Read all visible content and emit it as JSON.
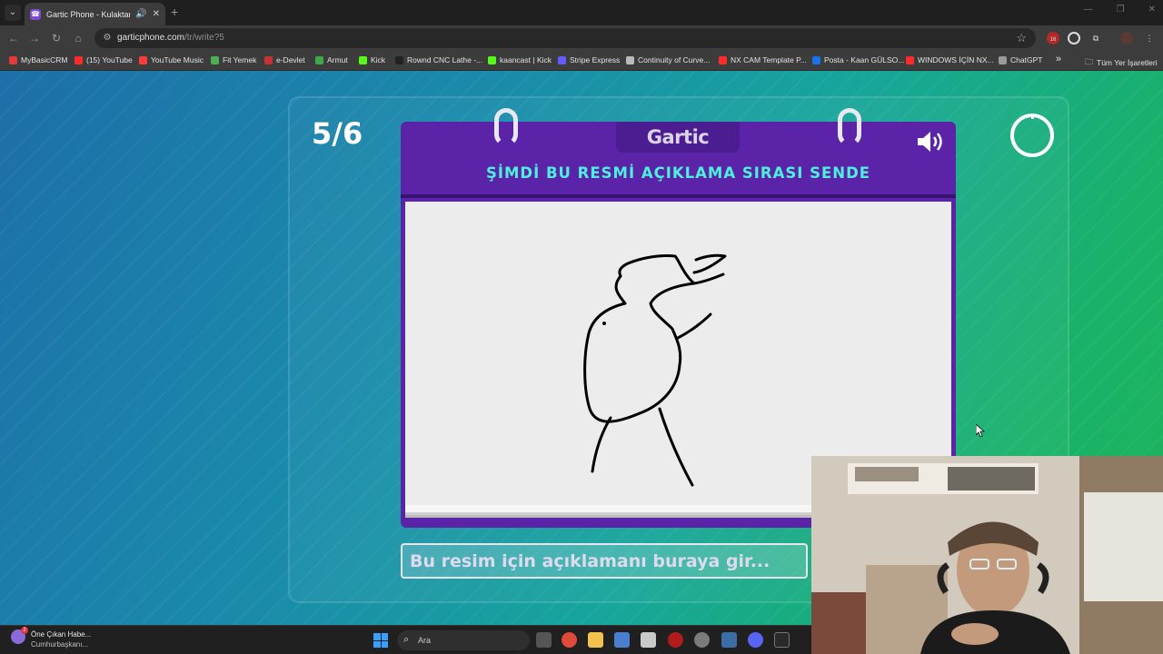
{
  "browser": {
    "tab_title": "Gartic Phone - Kulaktan Ku",
    "tab_audio_icon": "speaker-icon",
    "new_tab": "+",
    "url_host": "garticphone.com",
    "url_path": "/tr/write?5",
    "extension_badge": "16"
  },
  "bookmarks": [
    {
      "label": "MyBasicCRM",
      "color": "#e23b3b"
    },
    {
      "label": "(15) YouTube",
      "color": "#ff2a2a"
    },
    {
      "label": "YouTube Music",
      "color": "#ff3b3b"
    },
    {
      "label": "Fit Yemek",
      "color": "#4caf50"
    },
    {
      "label": "e-Devlet",
      "color": "#c83232"
    },
    {
      "label": "Armut",
      "color": "#3ea84a"
    },
    {
      "label": "Kick",
      "color": "#53fc18"
    },
    {
      "label": "Rownd CNC Lathe -...",
      "color": "#222222"
    },
    {
      "label": "kaancast | Kick",
      "color": "#53fc18"
    },
    {
      "label": "Stripe Express",
      "color": "#635bff"
    },
    {
      "label": "Continuity of Curve...",
      "color": "#bbbbbb"
    },
    {
      "label": "NX CAM Template P...",
      "color": "#ff2a2a"
    },
    {
      "label": "Posta - Kaan GÜLSO...",
      "color": "#1a73e8"
    },
    {
      "label": "WINDOWS İÇİN NX...",
      "color": "#ff2a2a"
    },
    {
      "label": "ChatGPT",
      "color": "#9a9a9a"
    }
  ],
  "bookmarks_overflow": "»",
  "bookmarks_all": "Tüm Yer İşaretleri",
  "game": {
    "round": "5/6",
    "logo": "Gartic",
    "instruction": "ŞİMDİ BU RESMİ AÇIKLAMA SIRASI SENDE",
    "answer_placeholder": "Bu resim için açıklamanı buraya gir...",
    "answer_value": ""
  },
  "taskbar": {
    "news_title": "Öne Çıkan Habe...",
    "news_sub": "Cumhurbaşkanı...",
    "news_badge": "2",
    "search_label": "Ara"
  }
}
